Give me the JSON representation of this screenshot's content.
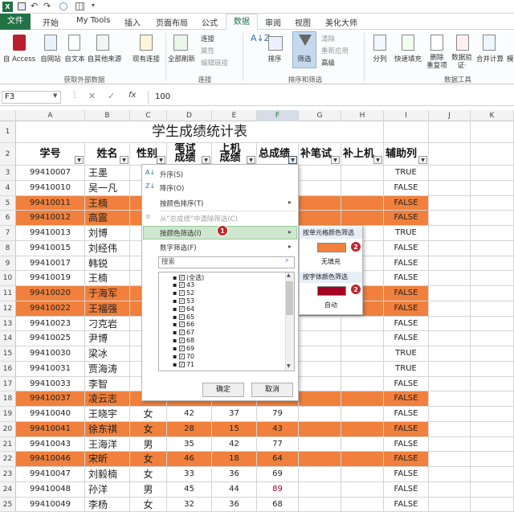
{
  "ribbon": {
    "tabs": [
      {
        "label": "文件",
        "active": true
      },
      {
        "label": "开始"
      },
      {
        "label": "My Tools"
      },
      {
        "label": "插入"
      },
      {
        "label": "页面布局"
      },
      {
        "label": "公式"
      },
      {
        "label": "数据",
        "current": true
      },
      {
        "label": "审阅"
      },
      {
        "label": "视图"
      },
      {
        "label": "美化大师"
      }
    ],
    "buttons": {
      "access": "自 Access",
      "web": "自网站",
      "text": "自文本",
      "other": "自其他来源",
      "existing": "现有连接",
      "refresh_all": "全部刷新",
      "connections": "连接",
      "properties": "属性",
      "edit_links": "编辑链接",
      "sort": "排序",
      "filter": "筛选",
      "clear": "清除",
      "reapply": "重新应用",
      "advanced": "高级",
      "text_to_col": "分列",
      "flash_fill": "快速填充",
      "remove_dup": "删除\n重复项",
      "validation": "数据验\n证·",
      "consolidate": "合并计算",
      "model": "模"
    },
    "groups": {
      "external": "获取外部数据",
      "conn": "连接",
      "sortfilter": "排序和筛选",
      "tools": "数据工具"
    }
  },
  "formula": {
    "cell_ref": "F3",
    "value": "100",
    "fx": "fx"
  },
  "columns": [
    "A",
    "B",
    "C",
    "D",
    "E",
    "F",
    "G",
    "H",
    "I",
    "J",
    "K"
  ],
  "sheet": {
    "title": "学生成绩统计表",
    "headers": [
      "学号",
      "姓名",
      "性别",
      "笔试成绩",
      "上机成绩",
      "总成绩",
      "补笔试",
      "补上机",
      "辅助列"
    ],
    "rows": [
      {
        "r": "3",
        "id": "99410007",
        "name": "王墨",
        "g": "",
        "w": "",
        "m": "",
        "t": "",
        "aux": "TRUE",
        "hl": false
      },
      {
        "r": "4",
        "id": "99410010",
        "name": "吴一凡",
        "g": "",
        "w": "",
        "m": "",
        "t": "",
        "aux": "FALSE",
        "hl": false
      },
      {
        "r": "5",
        "id": "99410011",
        "name": "王楠",
        "g": "",
        "w": "",
        "m": "",
        "t": "",
        "aux": "FALSE",
        "hl": true
      },
      {
        "r": "6",
        "id": "99410012",
        "name": "高震",
        "g": "",
        "w": "",
        "m": "",
        "t": "",
        "aux": "FALSE",
        "hl": true
      },
      {
        "r": "7",
        "id": "99410013",
        "name": "刘博",
        "g": "",
        "w": "",
        "m": "",
        "t": "",
        "aux": "TRUE",
        "hl": false
      },
      {
        "r": "8",
        "id": "99410015",
        "name": "刘经伟",
        "g": "",
        "w": "",
        "m": "",
        "t": "",
        "aux": "FALSE",
        "hl": false
      },
      {
        "r": "9",
        "id": "99410017",
        "name": "韩锐",
        "g": "",
        "w": "",
        "m": "",
        "t": "",
        "aux": "FALSE",
        "hl": false
      },
      {
        "r": "10",
        "id": "99410019",
        "name": "王楠",
        "g": "",
        "w": "",
        "m": "",
        "t": "",
        "aux": "FALSE",
        "hl": false
      },
      {
        "r": "11",
        "id": "99410020",
        "name": "于海军",
        "g": "",
        "w": "",
        "m": "",
        "t": "",
        "aux": "FALSE",
        "hl": true
      },
      {
        "r": "12",
        "id": "99410022",
        "name": "王福强",
        "g": "",
        "w": "",
        "m": "",
        "t": "",
        "aux": "FALSE",
        "hl": true
      },
      {
        "r": "13",
        "id": "99410023",
        "name": "刁克岩",
        "g": "",
        "w": "",
        "m": "",
        "t": "",
        "aux": "FALSE",
        "hl": false
      },
      {
        "r": "14",
        "id": "99410025",
        "name": "尹博",
        "g": "",
        "w": "",
        "m": "",
        "t": "",
        "aux": "FALSE",
        "hl": false
      },
      {
        "r": "15",
        "id": "99410030",
        "name": "梁冰",
        "g": "",
        "w": "",
        "m": "",
        "t": "",
        "aux": "TRUE",
        "hl": false
      },
      {
        "r": "16",
        "id": "99410031",
        "name": "贾海涛",
        "g": "",
        "w": "",
        "m": "",
        "t": "",
        "aux": "TRUE",
        "hl": false
      },
      {
        "r": "17",
        "id": "99410033",
        "name": "李智",
        "g": "",
        "w": "",
        "m": "",
        "t": "",
        "aux": "FALSE",
        "hl": false
      },
      {
        "r": "18",
        "id": "99410037",
        "name": "凌云志",
        "g": "",
        "w": "",
        "m": "",
        "t": "",
        "aux": "FALSE",
        "hl": true
      },
      {
        "r": "19",
        "id": "99410040",
        "name": "王晓宇",
        "g": "女",
        "w": "42",
        "m": "37",
        "t": "79",
        "aux": "FALSE",
        "hl": false
      },
      {
        "r": "20",
        "id": "99410041",
        "name": "徐东祺",
        "g": "女",
        "w": "28",
        "m": "15",
        "t": "43",
        "aux": "FALSE",
        "hl": true
      },
      {
        "r": "21",
        "id": "99410043",
        "name": "王海洋",
        "g": "男",
        "w": "35",
        "m": "42",
        "t": "77",
        "aux": "FALSE",
        "hl": false
      },
      {
        "r": "22",
        "id": "99410046",
        "name": "宋昕",
        "g": "女",
        "w": "46",
        "m": "18",
        "t": "64",
        "aux": "FALSE",
        "hl": true
      },
      {
        "r": "23",
        "id": "99410047",
        "name": "刘毅楠",
        "g": "女",
        "w": "33",
        "m": "36",
        "t": "69",
        "aux": "FALSE",
        "hl": false
      },
      {
        "r": "24",
        "id": "99410048",
        "name": "孙洋",
        "g": "男",
        "w": "45",
        "m": "44",
        "t": "89",
        "aux": "FALSE",
        "hl": false,
        "tred": true
      },
      {
        "r": "25",
        "id": "99410049",
        "name": "李杨",
        "g": "女",
        "w": "32",
        "m": "36",
        "t": "68",
        "aux": "FALSE",
        "hl": false
      }
    ]
  },
  "menu": {
    "sort_asc": "升序(S)",
    "sort_desc": "降序(O)",
    "sort_color": "按颜色排序(T)",
    "clear_filter": "从\"总成绩\"中清除筛选(C)",
    "filter_color": "按颜色筛选(I)",
    "num_filter": "数字筛选(F)",
    "search_placeholder": "搜索",
    "items": [
      "(全选)",
      "43",
      "52",
      "53",
      "64",
      "65",
      "66",
      "67",
      "68",
      "69",
      "70",
      "71"
    ],
    "ok": "确定",
    "cancel": "取消"
  },
  "submenu": {
    "cell_color": "按单元格颜色筛选",
    "no_fill": "无填充",
    "font_color": "按字体颜色筛选",
    "auto": "自动"
  },
  "badges": {
    "one": "1",
    "two": "2"
  },
  "colors": {
    "orange": "#f0803c",
    "darkred": "#a5001e",
    "excel_green": "#217346",
    "header_blue": "#2a5caa"
  }
}
